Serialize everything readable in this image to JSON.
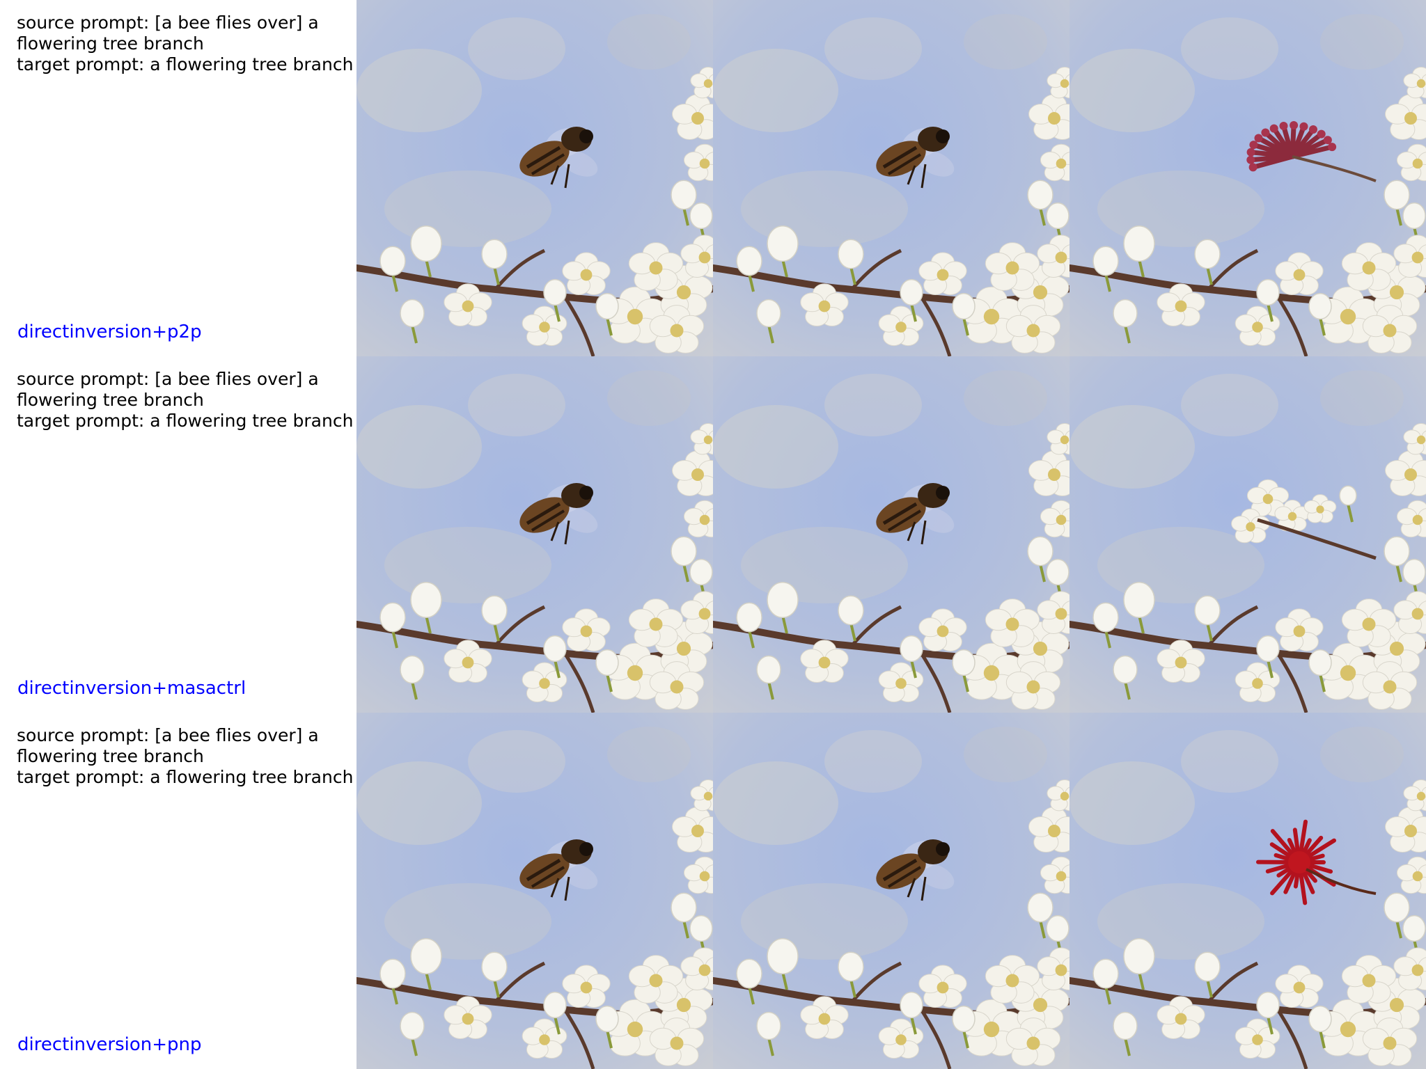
{
  "rows": [
    {
      "source_prompt": "source prompt: [a bee flies over] a flowering tree branch",
      "target_prompt": "target prompt: a flowering tree branch",
      "method": "directinversion+p2p",
      "panels": [
        "bee",
        "bee",
        "red-blossom-cluster"
      ]
    },
    {
      "source_prompt": "source prompt: [a bee flies over] a flowering tree branch",
      "target_prompt": "target prompt: a flowering tree branch",
      "method": "directinversion+masactrl",
      "panels": [
        "bee",
        "bee",
        "white-blossom-cluster"
      ]
    },
    {
      "source_prompt": "source prompt: [a bee flies over] a flowering tree branch",
      "target_prompt": "target prompt: a flowering tree branch",
      "method": "directinversion+pnp",
      "panels": [
        "bee",
        "bee",
        "red-flower-burst"
      ]
    }
  ],
  "colors": {
    "method_label": "#0000ff",
    "prompt_text": "#000000",
    "sky_blue": "#9fb4e0",
    "blossom_white": "#f4f2ea",
    "branch_brown": "#5a3a2c"
  }
}
